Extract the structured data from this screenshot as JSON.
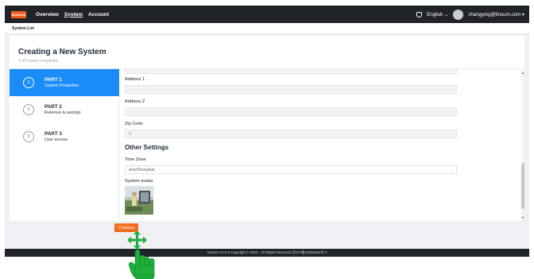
{
  "header": {
    "logo_text": "SINBASE",
    "nav": [
      "Overview",
      "System",
      "Account"
    ],
    "active_nav": "System",
    "language": "English",
    "user_email": "zhangying@linsum.com"
  },
  "breadcrumb": "System List",
  "page": {
    "title": "Creating a New System",
    "subtitle": "1 of 3 parts completed"
  },
  "steps": [
    {
      "num": "1",
      "title": "PART 1",
      "subtitle": "System Properties",
      "active": true
    },
    {
      "num": "2",
      "title": "PART 2",
      "subtitle": "Revenue & savings",
      "active": false
    },
    {
      "num": "3",
      "title": "PART 3",
      "subtitle": "User access",
      "active": false
    }
  ],
  "form": {
    "address1_label": "Address 1",
    "address1_value": "",
    "address2_label": "Address 2",
    "address2_value": "",
    "zip_label": "Zip Code",
    "zip_value": "0",
    "other_settings_heading": "Other Settings",
    "timezone_label": "Time Zone",
    "timezone_value": "Asia/Shanghai",
    "avatar_label": "System avatar"
  },
  "continue_label": "Continue",
  "footer_text": "Version V1.0.0   Copyright © 2023 . All Rights Reserved   京ICP备19035493号-2",
  "colors": {
    "accent_blue": "#1a8cf7",
    "accent_orange": "#f26d21",
    "topbar": "#202428",
    "cursor_green": "#1fae3c"
  },
  "icons": {
    "bell": "notification-icon",
    "chevron": "chevron-down-icon",
    "cursor": "move-hand-cursor-icon"
  }
}
